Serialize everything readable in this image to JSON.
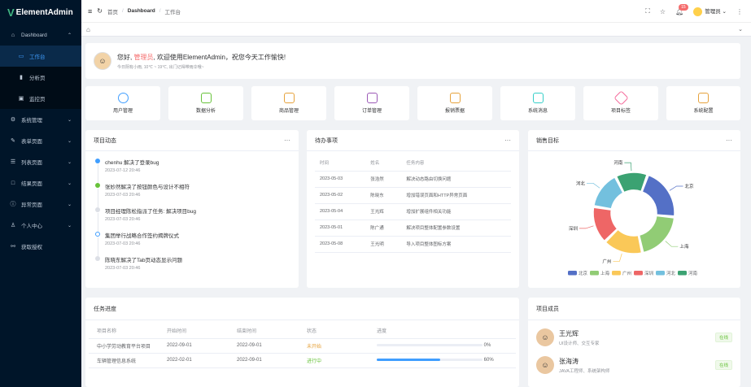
{
  "app": {
    "logo_letter": "V",
    "title": "ElementAdmin"
  },
  "sidebar": {
    "items": [
      {
        "label": "Dashboard",
        "icon": "home-icon"
      },
      {
        "label": "工作台",
        "icon": "monitor-icon"
      },
      {
        "label": "分析页",
        "icon": "bar-chart-icon"
      },
      {
        "label": "监控页",
        "icon": "screen-icon"
      },
      {
        "label": "系统管理",
        "icon": "gear-icon"
      },
      {
        "label": "表单页面",
        "icon": "edit-icon"
      },
      {
        "label": "列表页面",
        "icon": "list-icon"
      },
      {
        "label": "结果页面",
        "icon": "book-icon"
      },
      {
        "label": "异常页面",
        "icon": "warning-icon"
      },
      {
        "label": "个人中心",
        "icon": "user-icon"
      },
      {
        "label": "获取授权",
        "icon": "link-icon"
      }
    ]
  },
  "header": {
    "breadcrumb": [
      "首页",
      "Dashboard",
      "工作台"
    ],
    "notification_count": "15",
    "user": "管理员"
  },
  "welcome": {
    "greeting_pre": "您好, ",
    "name": "管理员",
    "greeting_post": ", 欢迎使用ElementAdmin，祝您今天工作愉快!",
    "sub": "今日阴有小雨, 10℃ ~ 19℃, 出门记得带雨伞哦~"
  },
  "quick": [
    {
      "label": "用户管理",
      "icon": "user-icon",
      "color": "#409eff"
    },
    {
      "label": "数据分析",
      "icon": "chart-icon",
      "color": "#67c23a"
    },
    {
      "label": "商品管理",
      "icon": "bag-icon",
      "color": "#e6a23c"
    },
    {
      "label": "订单管理",
      "icon": "document-icon",
      "color": "#9b59b6"
    },
    {
      "label": "报销票据",
      "icon": "ticket-icon",
      "color": "#e6a23c"
    },
    {
      "label": "系统消息",
      "icon": "message-icon",
      "color": "#36cfc9"
    },
    {
      "label": "项目标签",
      "icon": "tag-icon",
      "color": "#f56c9c"
    },
    {
      "label": "系统配置",
      "icon": "sliders-icon",
      "color": "#e6a23c"
    }
  ],
  "dynamic": {
    "title": "项目动态",
    "items": [
      {
        "text": "chenhu 解决了登录bug",
        "time": "2023-07-12 20:46",
        "color": "#409eff"
      },
      {
        "text": "张妙然解决了按钮颜色与设计不相符",
        "time": "2023-07-03 20:46",
        "color": "#67c23a"
      },
      {
        "text": "项目经理陈松指派了任务: 解决项目bug",
        "time": "2023-07-03 20:46",
        "color": "#dcdfe6"
      },
      {
        "text": "集团举行战略合作签约揭牌仪式",
        "time": "2023-07-03 20:46",
        "color": "#409eff"
      },
      {
        "text": "陈晓东解决了Tab页动态显示问题",
        "time": "2023-07-03 20:46",
        "color": "#dcdfe6"
      }
    ]
  },
  "todo": {
    "title": "待办事项",
    "columns": [
      "时间",
      "姓名",
      "任务内容"
    ],
    "rows": [
      [
        "2023-05-03",
        "张浩然",
        "解决动态路由切换问题"
      ],
      [
        "2023-05-02",
        "陈晓东",
        "增加错误页面和HTTP异常页面"
      ],
      [
        "2023-05-04",
        "王光辉",
        "增加扩展组件相关功能"
      ],
      [
        "2023-05-01",
        "陈广通",
        "解决项目整体配置参数设置"
      ],
      [
        "2023-05-08",
        "王光明",
        "导入项目整体图标方案"
      ]
    ]
  },
  "sales": {
    "title": "销售目标",
    "chart_data": {
      "type": "pie",
      "categories": [
        "北京",
        "上海",
        "广州",
        "深圳",
        "河北",
        "河南"
      ],
      "values": [
        21,
        20,
        16,
        15,
        15,
        13
      ],
      "colors": [
        "#5470c6",
        "#91cc75",
        "#fac858",
        "#ee6666",
        "#73c0de",
        "#3ba272"
      ],
      "legend": "bottom"
    }
  },
  "progress": {
    "title": "任务进度",
    "columns": [
      "项目名称",
      "开始时间",
      "结束时间",
      "状态",
      "进度"
    ],
    "rows": [
      {
        "name": "中小学劳动教育平台项目",
        "start": "2022-09-01",
        "end": "2022-09-01",
        "status": "未开始",
        "status_color": "#e6a23c",
        "percent": 0,
        "percent_label": "0%"
      },
      {
        "name": "车辆管理信息系统",
        "start": "2022-02-01",
        "end": "2022-09-01",
        "status": "进行中",
        "status_color": "#67c23a",
        "percent": 60,
        "percent_label": "60%"
      }
    ]
  },
  "members": {
    "title": "项目成员",
    "items": [
      {
        "name": "王光辉",
        "role": "UI设计师、交互专家",
        "tag": "在线"
      },
      {
        "name": "张海涛",
        "role": "JAVA工程师、系统架构师",
        "tag": "在线"
      }
    ]
  }
}
